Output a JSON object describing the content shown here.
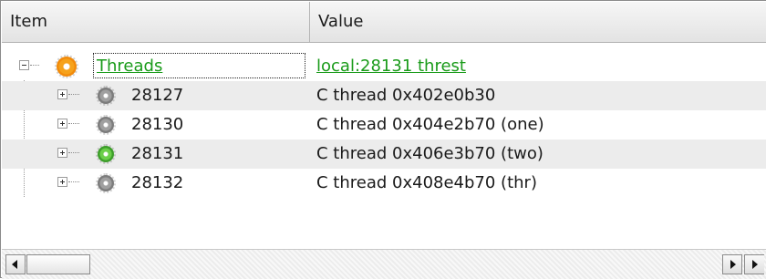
{
  "header": {
    "col_item": "Item",
    "col_value": "Value"
  },
  "root": {
    "name": "Threads",
    "value": "local:28131 threst",
    "icon": "gear-orange-icon",
    "expanded": true
  },
  "threads": [
    {
      "id": "28127",
      "value": "C thread 0x402e0b30",
      "icon": "gear-grey-icon",
      "current": false
    },
    {
      "id": "28130",
      "value": "C thread 0x404e2b70 (one)",
      "icon": "gear-grey-icon",
      "current": false
    },
    {
      "id": "28131",
      "value": "C thread 0x406e3b70 (two)",
      "icon": "gear-green-icon",
      "current": true
    },
    {
      "id": "28132",
      "value": "C thread 0x408e4b70 (thr)",
      "icon": "gear-grey-icon",
      "current": false
    }
  ],
  "colors": {
    "link": "#1a9b1a",
    "alt_row": "#ececec",
    "gear_orange": "#f28a0a",
    "gear_green": "#3d9e2a",
    "gear_grey": "#7c7c7c"
  }
}
